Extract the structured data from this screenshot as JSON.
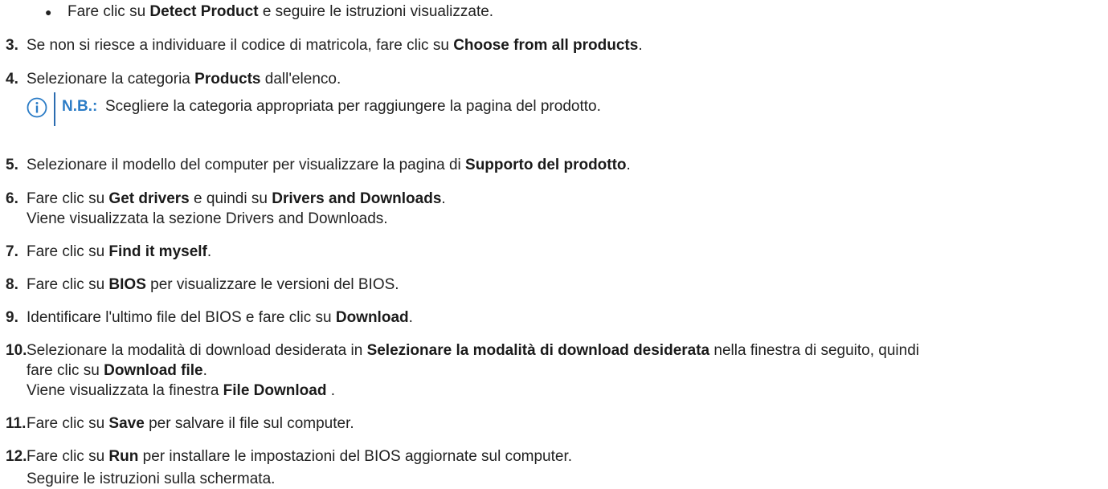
{
  "bullet": {
    "pre": "Fare clic su ",
    "bold": "Detect Product",
    "post": " e seguire le istruzioni visualizzate."
  },
  "steps": {
    "s3": {
      "num": "3.",
      "pre": "Se non si riesce a individuare il codice di matricola, fare clic su ",
      "bold": "Choose from all products",
      "post": "."
    },
    "s4": {
      "num": "4.",
      "pre": "Selezionare la categoria ",
      "bold": "Products",
      "post": " dall'elenco."
    },
    "s5": {
      "num": "5.",
      "pre": "Selezionare il modello del computer per visualizzare la pagina di ",
      "bold": "Supporto del prodotto",
      "post": "."
    },
    "s6": {
      "num": "6.",
      "pre": "Fare clic su ",
      "bold1": "Get drivers",
      "mid": " e quindi su ",
      "bold2": "Drivers and Downloads",
      "post": ".",
      "sub": "Viene visualizzata la sezione Drivers and Downloads."
    },
    "s7": {
      "num": "7.",
      "pre": "Fare clic su ",
      "bold": "Find it myself",
      "post": "."
    },
    "s8": {
      "num": "8.",
      "pre": "Fare clic su ",
      "bold": "BIOS",
      "post": " per visualizzare le versioni del BIOS."
    },
    "s9": {
      "num": "9.",
      "pre": "Identificare l'ultimo file del BIOS e fare clic su ",
      "bold": "Download",
      "post": "."
    },
    "s10": {
      "num": "10.",
      "pre": "Selezionare la modalità di download desiderata in ",
      "bold": "Selezionare la modalità di download desiderata",
      "post": " nella finestra di seguito, quindi",
      "line2_pre": "fare clic su ",
      "line2_bold": "Download file",
      "line2_post": ".",
      "line3_pre": "Viene visualizzata la finestra ",
      "line3_bold": "File Download",
      "line3_post": " ."
    },
    "s11": {
      "num": "11.",
      "pre": "Fare clic su ",
      "bold": "Save",
      "post": " per salvare il file sul computer."
    },
    "s12": {
      "num": "12.",
      "pre": "Fare clic su ",
      "bold": "Run",
      "post": " per installare le impostazioni del BIOS aggiornate sul computer.",
      "sub": "Seguire le istruzioni sulla schermata."
    }
  },
  "note": {
    "icon": "info-icon",
    "label": "N.B.:",
    "text": " Scegliere la categoria appropriata per raggiungere la pagina del prodotto.",
    "accent": "#2b7cc6"
  }
}
